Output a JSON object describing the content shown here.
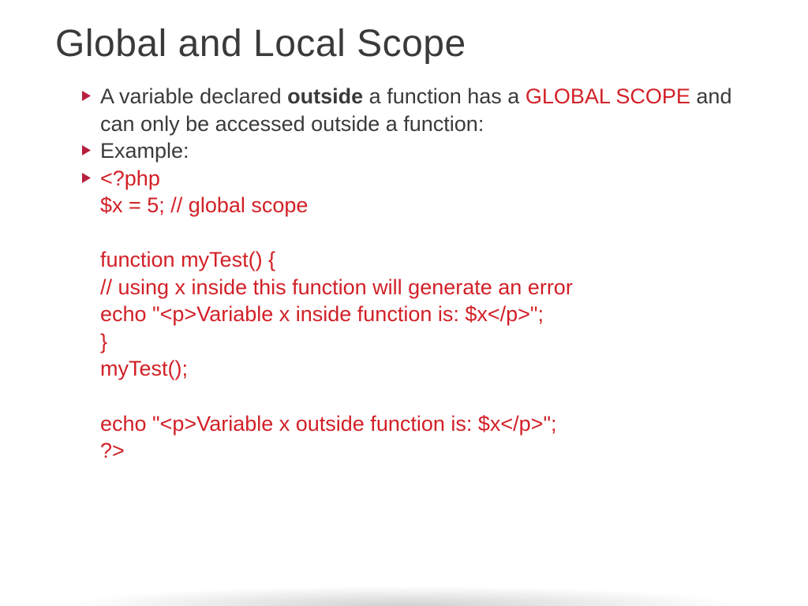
{
  "title": "Global and Local Scope",
  "bullets": {
    "b1_pre": "A variable declared ",
    "b1_strong": "outside",
    "b1_mid": " a function has a ",
    "b1_red": "GLOBAL SCOPE",
    "b1_post": " and can only be accessed outside a function:",
    "b2": "Example:",
    "code": "<?php\n$x = 5; // global scope\n\nfunction myTest() {\n// using x inside this function will generate an error\necho \"<p>Variable x inside function is: $x</p>\";\n}\nmyTest();\n\necho \"<p>Variable x outside function is: $x</p>\";\n?>"
  },
  "colors": {
    "accent": "#d22027",
    "text": "#3a3a3a",
    "bullet": "#b81f3f"
  }
}
